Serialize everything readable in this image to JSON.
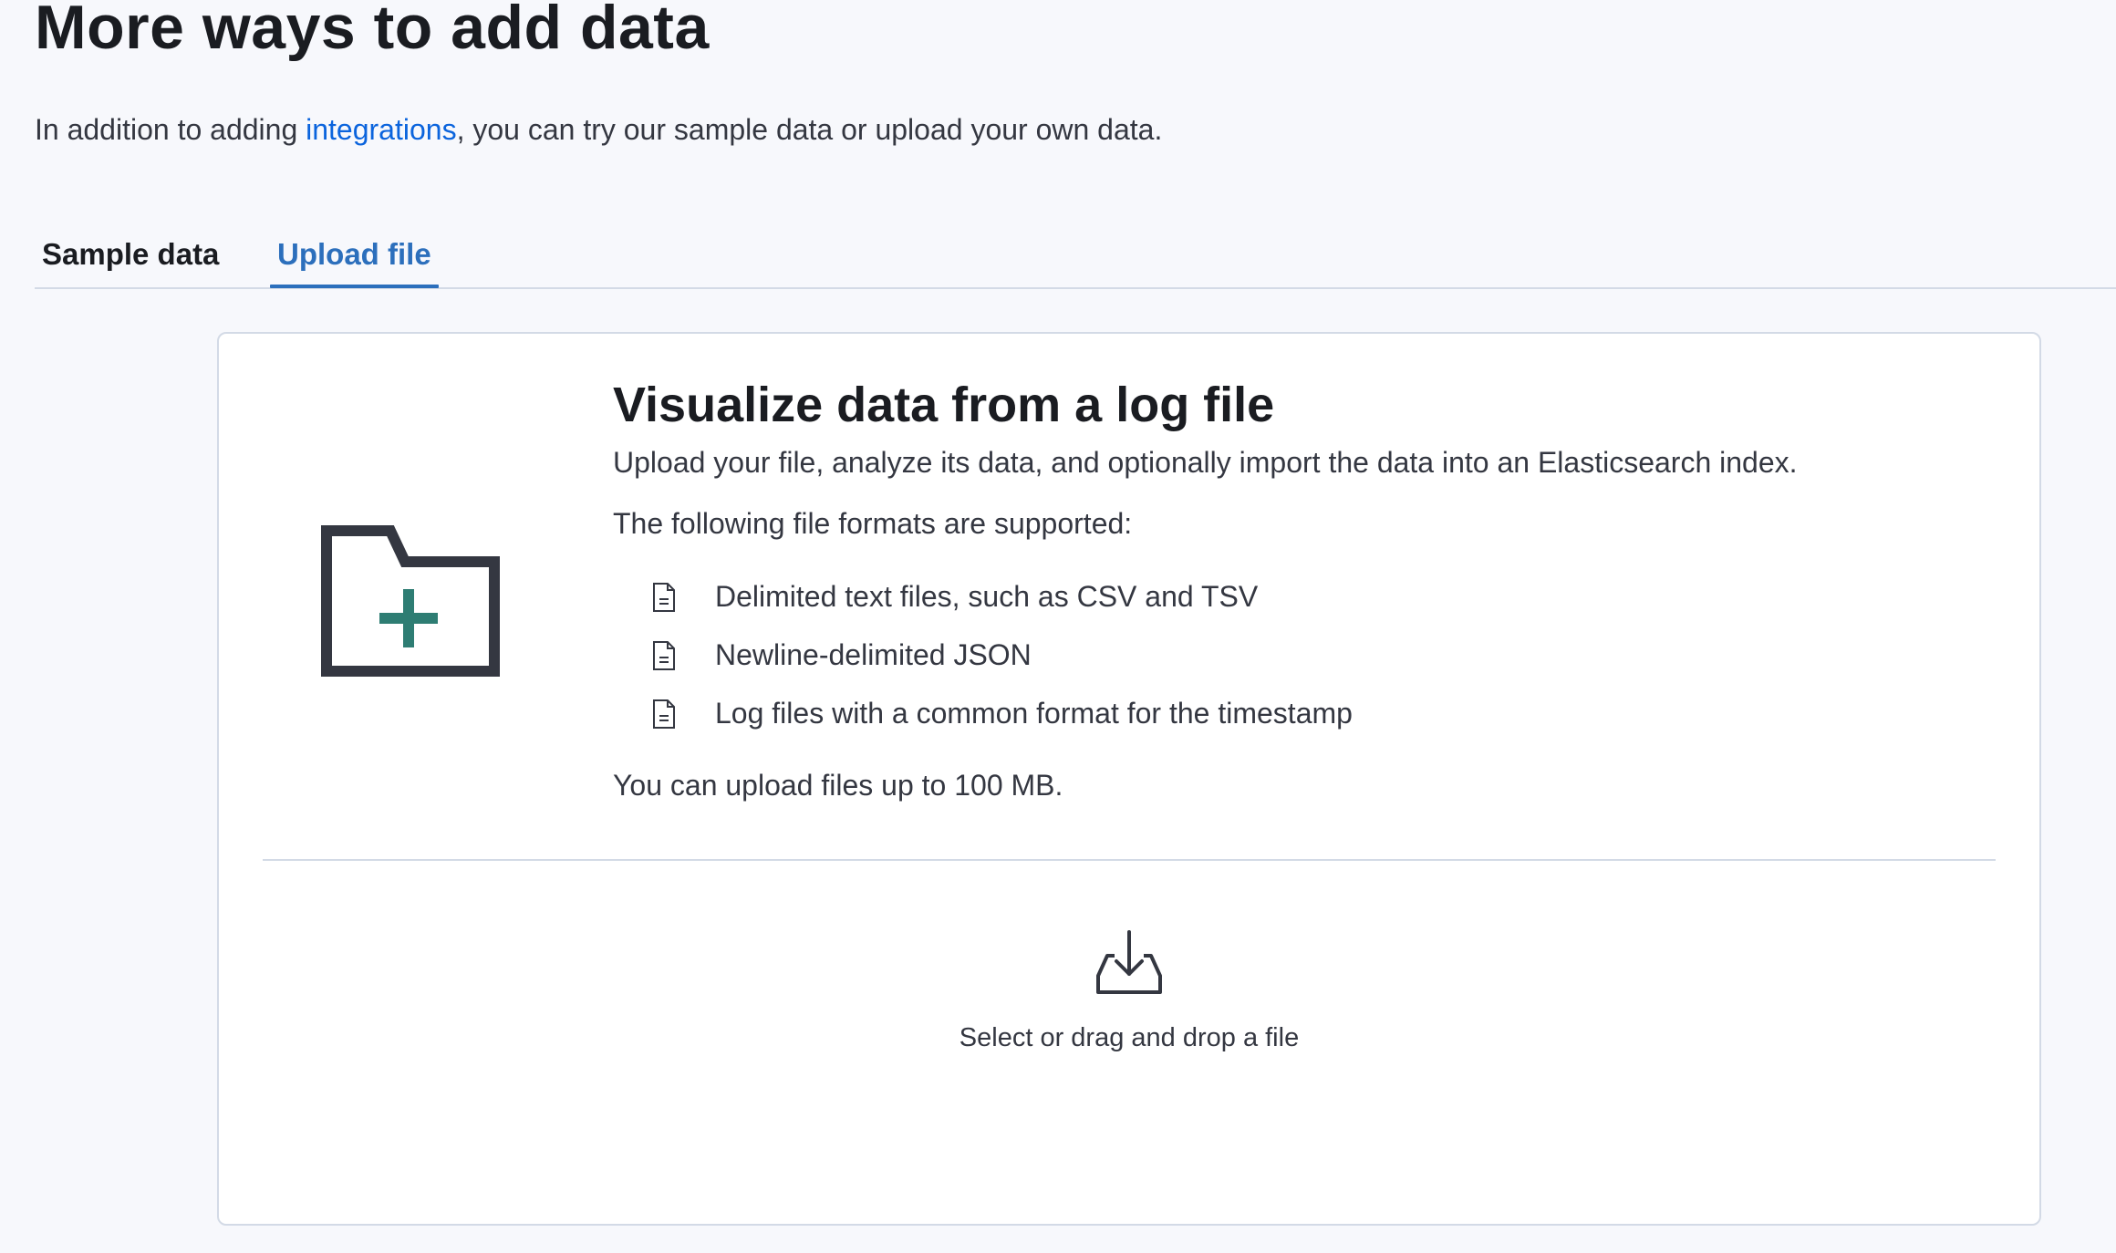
{
  "page": {
    "title": "More ways to add data",
    "intro_before": "In addition to adding ",
    "intro_link": "integrations",
    "intro_after": ", you can try our sample data or upload your own data."
  },
  "tabs": [
    {
      "label": "Sample data",
      "selected": false
    },
    {
      "label": "Upload file",
      "selected": true
    }
  ],
  "card": {
    "icon": "folder-add-icon",
    "title": "Visualize data from a log file",
    "description": "Upload your file, analyze its data, and optionally import the data into an Elasticsearch index.",
    "formats_intro": "The following file formats are supported:",
    "formats": [
      {
        "icon": "document-icon",
        "label": "Delimited text files, such as CSV and TSV"
      },
      {
        "icon": "document-icon",
        "label": "Newline-delimited JSON"
      },
      {
        "icon": "document-icon",
        "label": "Log files with a common format for the timestamp"
      }
    ],
    "size_note": "You can upload files up to 100 MB."
  },
  "dropzone": {
    "icon": "upload-icon",
    "label": "Select or drag and drop a file"
  },
  "colors": {
    "link": "#0b64dd",
    "tab_selected": "#2c6fbc",
    "folder_plus": "#2e7d73",
    "background": "#f7f8fc"
  }
}
